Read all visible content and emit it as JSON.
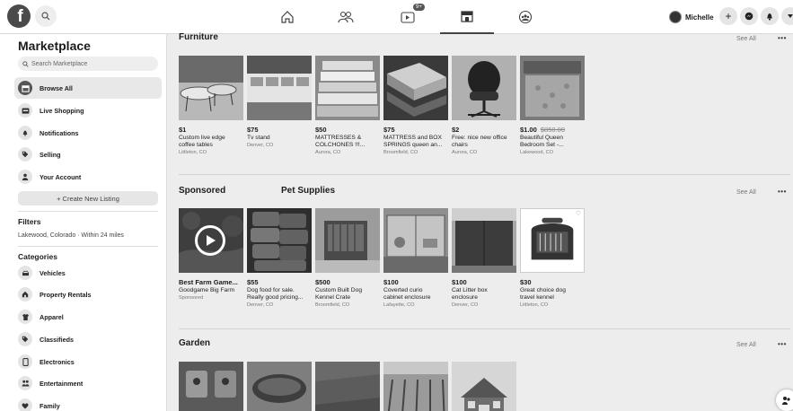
{
  "topbar": {
    "logo_letter": "f",
    "badge": "9+",
    "profile_name": "Michelle",
    "plus_label": "+"
  },
  "sidebar": {
    "title": "Marketplace",
    "search_placeholder": "Search Marketplace",
    "items": [
      {
        "label": "Browse All",
        "icon": "storefront-icon"
      },
      {
        "label": "Live Shopping",
        "icon": "live-icon"
      },
      {
        "label": "Notifications",
        "icon": "bell-icon"
      },
      {
        "label": "Selling",
        "icon": "tag-icon"
      },
      {
        "label": "Your Account",
        "icon": "person-icon"
      }
    ],
    "create_label": "+ Create New Listing",
    "filters_title": "Filters",
    "filters_text": "Lakewood, Colorado · Within 24 miles",
    "categories_title": "Categories",
    "categories": [
      {
        "label": "Vehicles",
        "icon": "car-icon"
      },
      {
        "label": "Property Rentals",
        "icon": "house-icon"
      },
      {
        "label": "Apparel",
        "icon": "shirt-icon"
      },
      {
        "label": "Classifieds",
        "icon": "tag-icon"
      },
      {
        "label": "Electronics",
        "icon": "phone-icon"
      },
      {
        "label": "Entertainment",
        "icon": "people-icon"
      },
      {
        "label": "Family",
        "icon": "heart-icon"
      }
    ]
  },
  "sections": {
    "furniture": {
      "title": "Furniture",
      "see_all": "See All",
      "more": "•••",
      "items": [
        {
          "price": "$1",
          "old_price": "",
          "desc": [
            "Custom live edge",
            "coffee tables"
          ],
          "loc": "Littleton, CO"
        },
        {
          "price": "$75",
          "old_price": "",
          "desc": [
            "Tv stand"
          ],
          "loc": "Denver, CO"
        },
        {
          "price": "$50",
          "old_price": "",
          "desc": [
            "MATTRESSES &",
            "COLCHONES !!!..."
          ],
          "loc": "Aurora, CO"
        },
        {
          "price": "$75",
          "old_price": "",
          "desc": [
            "MATTRESS and BOX",
            "SPRINGS queen an..."
          ],
          "loc": "Broomfield, CO"
        },
        {
          "price": "$2",
          "old_price": "",
          "desc": [
            "Free: nice new office",
            "chairs"
          ],
          "loc": "Aurora, CO"
        },
        {
          "price": "$1.00",
          "old_price": "$850.00",
          "desc": [
            "Beautiful Queen",
            "Bedroom Set -..."
          ],
          "loc": "Lakewood, CO"
        }
      ]
    },
    "sponsored": {
      "title": "Sponsored",
      "title2": "Pet Supplies",
      "see_all": "See All",
      "more": "•••",
      "items": [
        {
          "price": "Best Farm Game...",
          "old_price": "",
          "desc": [
            "Goodgame Big Farm"
          ],
          "loc": "Sponsored"
        },
        {
          "price": "$55",
          "old_price": "",
          "desc": [
            "Dog food for sale.",
            "Really good pricing..."
          ],
          "loc": "Denver, CO"
        },
        {
          "price": "$500",
          "old_price": "",
          "desc": [
            "Custom Built Dog",
            "Kennel Crate"
          ],
          "loc": "Broomfield, CO"
        },
        {
          "price": "$100",
          "old_price": "",
          "desc": [
            "Coverted curio",
            "cabinet enclosure"
          ],
          "loc": "Lafayette, CO"
        },
        {
          "price": "$100",
          "old_price": "",
          "desc": [
            "Cat Litter box",
            "enclosure"
          ],
          "loc": "Denver, CO"
        },
        {
          "price": "$30",
          "old_price": "",
          "desc": [
            "Great choice dog",
            "travel kennel"
          ],
          "loc": "Littleton, CO"
        }
      ]
    },
    "garden": {
      "title": "Garden",
      "see_all": "See All",
      "more": "•••"
    }
  }
}
